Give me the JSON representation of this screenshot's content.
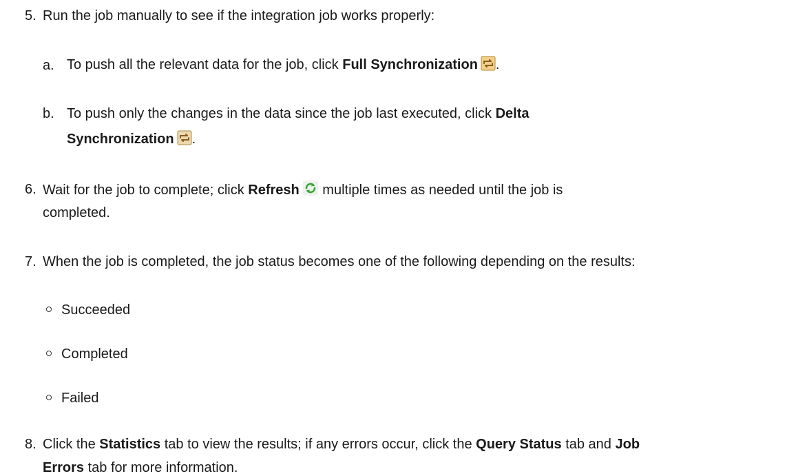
{
  "steps": {
    "s5": {
      "num": "5.",
      "text": "Run the job manually to see if the integration job works properly:",
      "a": {
        "num": "a.",
        "pre": "To push all the relevant data for the job, click ",
        "bold": "Full Synchronization",
        "post": "."
      },
      "b": {
        "num": "b.",
        "pre": "To push only the changes in the data since the job last executed, click ",
        "bold1": "Delta",
        "bold2": "Synchronization",
        "post": "."
      }
    },
    "s6": {
      "num": "6.",
      "pre": "Wait for the job to complete; click ",
      "bold": "Refresh",
      "post": " multiple times as needed until the job is",
      "cont": "completed."
    },
    "s7": {
      "num": "7.",
      "text": "When the job is completed, the job status becomes one of the following depending on the results:",
      "bullets": [
        "Succeeded",
        "Completed",
        "Failed"
      ]
    },
    "s8": {
      "num": "8.",
      "pre": "Click the ",
      "bold1": "Statistics",
      "mid1": " tab to view the results; if any errors occur, click the ",
      "bold2": "Query Status",
      "mid2": " tab and ",
      "bold3": "Job",
      "bold4": "Errors",
      "post": " tab for more information."
    }
  },
  "icons": {
    "full_sync": "full-synchronization-icon",
    "delta_sync": "delta-synchronization-icon",
    "refresh": "refresh-icon"
  },
  "colors": {
    "text": "#1a1a1a",
    "sync_icon_brown": "#8a5a1c",
    "sync_icon_bg": "#f2d08a",
    "refresh_green": "#3aa53a"
  }
}
